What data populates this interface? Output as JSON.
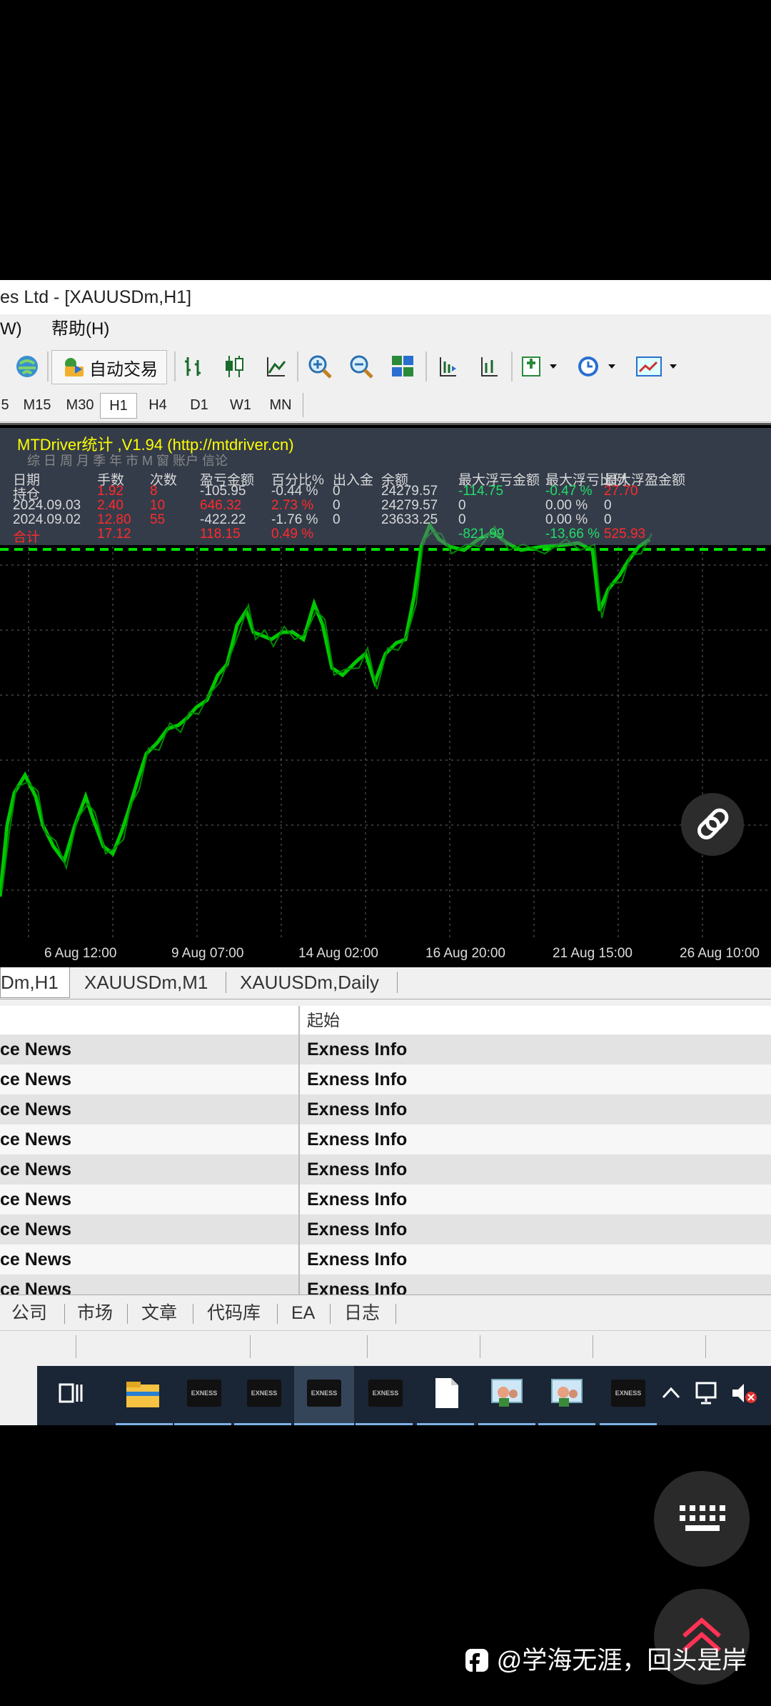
{
  "window": {
    "title": "es Ltd - [XAUUSDm,H1]"
  },
  "menu": {
    "items": [
      "W)",
      "帮助(H)"
    ]
  },
  "toolbar": {
    "auto_trading_label": "自动交易"
  },
  "timeframes": [
    "5",
    "M15",
    "M30",
    "H1",
    "H4",
    "D1",
    "W1",
    "MN"
  ],
  "active_timeframe": "H1",
  "indicator": {
    "title": "MTDriver统计 ,V1.94 (http://mtdriver.cn)",
    "tabs_row": "综 日 周 月 季 年 市 M 窗 账户 信论",
    "headers": [
      "日期",
      "手数",
      "次数",
      "盈亏金额",
      "百分比%",
      "出入金",
      "余额",
      "最大浮亏金额",
      "最大浮亏比例",
      "最大浮盈金额"
    ],
    "rows": [
      {
        "date": "持仓",
        "lots": "1.92",
        "count": "8",
        "pnl": "-105.95",
        "pct": "-0.44 %",
        "io": "0",
        "balance": "24279.57",
        "max_loss": "-114.75",
        "max_loss_pct": "-0.47 %",
        "max_profit": "27.70"
      },
      {
        "date": "2024.09.03",
        "lots": "2.40",
        "count": "10",
        "pnl": "646.32",
        "pct": "2.73 %",
        "io": "0",
        "balance": "24279.57",
        "max_loss": "0",
        "max_loss_pct": "0.00 %",
        "max_profit": "0"
      },
      {
        "date": "2024.09.02",
        "lots": "12.80",
        "count": "55",
        "pnl": "-422.22",
        "pct": "-1.76 %",
        "io": "0",
        "balance": "23633.25",
        "max_loss": "0",
        "max_loss_pct": "0.00 %",
        "max_profit": "0"
      },
      {
        "date": "合计",
        "lots": "17.12",
        "count": "",
        "pnl": "118.15",
        "pct": "0.49 %",
        "io": "",
        "balance": "",
        "max_loss": "-821.99",
        "max_loss_pct": "-13.66 %",
        "max_profit": "525.93"
      }
    ]
  },
  "x_axis_labels": [
    "6 Aug 12:00",
    "9 Aug 07:00",
    "14 Aug 02:00",
    "16 Aug 20:00",
    "21 Aug 15:00",
    "26 Aug 10:00"
  ],
  "chart_tabs": [
    "Dm,H1",
    "XAUUSDm,M1",
    "XAUUSDm,Daily"
  ],
  "news_table": {
    "header_col2": "起始",
    "rows": [
      {
        "c1": "ce News",
        "c2": "Exness Info"
      },
      {
        "c1": "ce News",
        "c2": "Exness Info"
      },
      {
        "c1": "ce News",
        "c2": "Exness Info"
      },
      {
        "c1": "ce News",
        "c2": "Exness Info"
      },
      {
        "c1": "ce News",
        "c2": "Exness Info"
      },
      {
        "c1": "ce News",
        "c2": "Exness Info"
      },
      {
        "c1": "ce News",
        "c2": "Exness Info"
      },
      {
        "c1": "ce News",
        "c2": "Exness Info"
      },
      {
        "c1": "ce News",
        "c2": "Exness Info"
      }
    ]
  },
  "bottom_tabs": [
    "公司",
    "市场",
    "文章",
    "代码库",
    "EA",
    "日志"
  ],
  "taskbar": {
    "exness_label": "EXNESS"
  },
  "watermark": "@学海无涯，回头是岸",
  "colors": {
    "candle_green": "#00c800",
    "level_line": "#00e000",
    "negative": "#ff2b2b",
    "positive": "#22dd66"
  }
}
